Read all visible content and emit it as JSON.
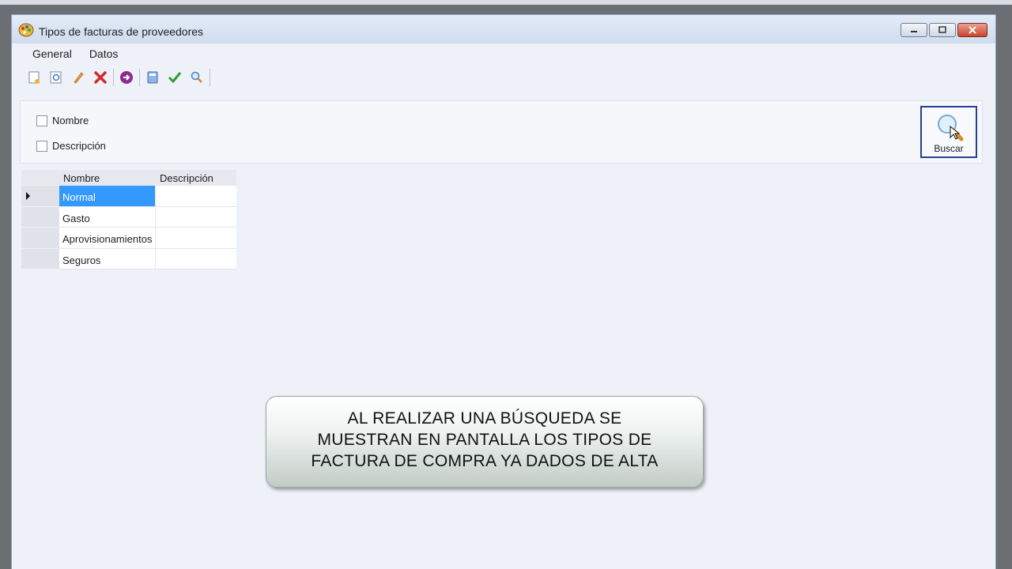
{
  "window": {
    "title": "Tipos de facturas de proveedores"
  },
  "menu": {
    "items": [
      "General",
      "Datos"
    ]
  },
  "filters": {
    "checkboxes": [
      {
        "label": "Nombre",
        "checked": false
      },
      {
        "label": "Descripción",
        "checked": false
      }
    ],
    "search_button_label": "Buscar"
  },
  "grid": {
    "columns": [
      "Nombre",
      "Descripción"
    ],
    "rows": [
      {
        "nombre": "Normal",
        "descripcion": ""
      },
      {
        "nombre": "Gasto",
        "descripcion": ""
      },
      {
        "nombre": "Aprovisionamientos",
        "descripcion": ""
      },
      {
        "nombre": "Seguros",
        "descripcion": ""
      }
    ],
    "selected_row": 0
  },
  "callout": {
    "lines": [
      "AL REALIZAR UNA BÚSQUEDA SE",
      "MUESTRAN EN PANTALLA LOS TIPOS DE",
      "FACTURA DE COMPRA YA DADOS DE ALTA"
    ]
  },
  "colors": {
    "selection": "#3399ff",
    "title_bar": "#d6e2f2",
    "close_button": "#c9452c"
  }
}
